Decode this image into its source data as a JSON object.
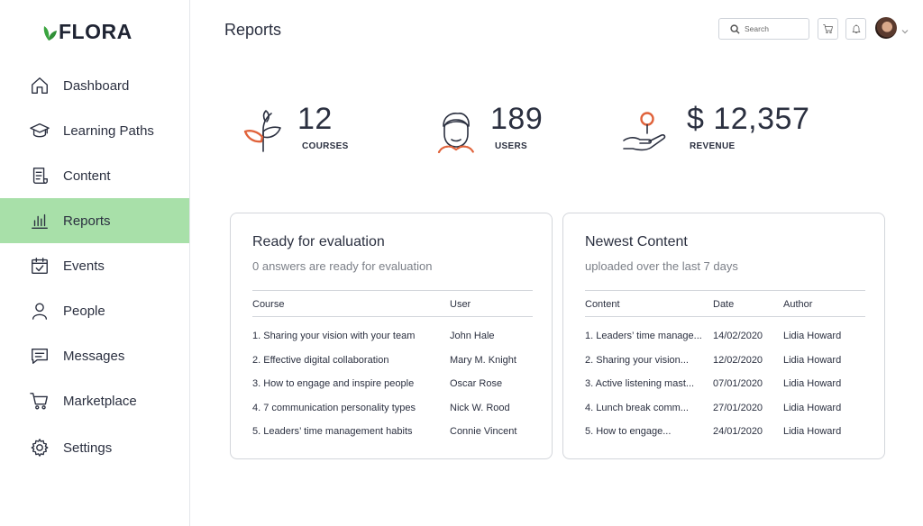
{
  "brand": {
    "name": "FLORA",
    "accent": "#3aa53f"
  },
  "sidebar": {
    "active_color": "#a8e0a9",
    "items": [
      {
        "label": "Dashboard",
        "icon": "home-icon"
      },
      {
        "label": "Learning Paths",
        "icon": "graduation-cap-icon"
      },
      {
        "label": "Content",
        "icon": "document-icon"
      },
      {
        "label": "Reports",
        "icon": "bar-chart-icon",
        "active": true
      },
      {
        "label": "Events",
        "icon": "calendar-check-icon"
      },
      {
        "label": "People",
        "icon": "person-icon"
      },
      {
        "label": "Messages",
        "icon": "message-icon"
      },
      {
        "label": "Marketplace",
        "icon": "cart-icon"
      },
      {
        "label": "Settings",
        "icon": "gear-icon"
      }
    ]
  },
  "header": {
    "title": "Reports",
    "search_placeholder": "Search"
  },
  "stats": [
    {
      "value": "12",
      "caption": "COURSES",
      "icon": "sprout-icon"
    },
    {
      "value": "189",
      "caption": "USERS",
      "icon": "user-face-icon"
    },
    {
      "value": "$ 12,357",
      "caption": "REVENUE",
      "icon": "hand-coin-icon"
    }
  ],
  "evaluation": {
    "title": "Ready for evaluation",
    "subtitle": "0 answers are ready for evaluation",
    "columns": [
      "Course",
      "User"
    ],
    "rows": [
      [
        "1. Sharing your vision with your team",
        "John Hale"
      ],
      [
        "2. Effective digital collaboration",
        "Mary M. Knight"
      ],
      [
        "3. How to engage and inspire people",
        "Oscar Rose"
      ],
      [
        "4. 7 communication personality types",
        "Nick W. Rood"
      ],
      [
        "5. Leaders’ time management habits",
        "Connie Vincent"
      ]
    ]
  },
  "newest": {
    "title": "Newest Content",
    "subtitle": "uploaded over the last 7 days",
    "columns": [
      "Content",
      "Date",
      "Author"
    ],
    "rows": [
      [
        "1. Leaders’ time manage...",
        "14/02/2020",
        "Lidia Howard"
      ],
      [
        "2. Sharing your vision...",
        "12/02/2020",
        "Lidia Howard"
      ],
      [
        "3. Active listening mast...",
        "07/01/2020",
        "Lidia Howard"
      ],
      [
        "4. Lunch break comm...",
        "27/01/2020",
        "Lidia Howard"
      ],
      [
        "5. How to engage...",
        "24/01/2020",
        "Lidia Howard"
      ]
    ]
  },
  "colors": {
    "icon_orange": "#e0623a",
    "text": "#2b3040"
  }
}
